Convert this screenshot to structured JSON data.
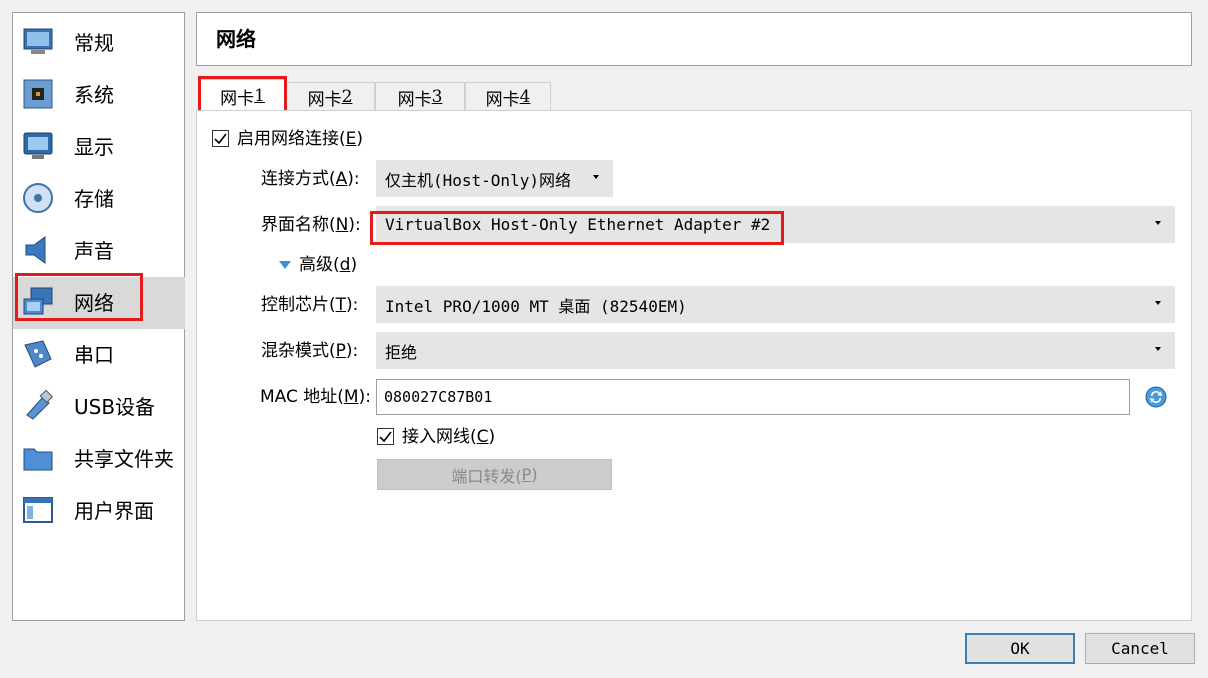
{
  "sidebar": {
    "items": [
      {
        "label": "常规",
        "icon": "general-monitor-icon"
      },
      {
        "label": "系统",
        "icon": "system-chip-icon"
      },
      {
        "label": "显示",
        "icon": "display-monitor-icon"
      },
      {
        "label": "存储",
        "icon": "storage-disk-icon"
      },
      {
        "label": "声音",
        "icon": "audio-speaker-icon"
      },
      {
        "label": "网络",
        "icon": "network-icon"
      },
      {
        "label": "串口",
        "icon": "serial-port-icon"
      },
      {
        "label": "USB设备",
        "icon": "usb-icon"
      },
      {
        "label": "共享文件夹",
        "icon": "shared-folder-icon"
      },
      {
        "label": "用户界面",
        "icon": "user-interface-icon"
      }
    ],
    "selected": "网络"
  },
  "header": {
    "title": "网络"
  },
  "tabs": [
    {
      "prefix": "网卡 ",
      "key": "1"
    },
    {
      "prefix": "网卡 ",
      "key": "2"
    },
    {
      "prefix": "网卡 ",
      "key": "3"
    },
    {
      "prefix": "网卡 ",
      "key": "4"
    }
  ],
  "form": {
    "enable_adapter": {
      "label": "启用网络连接(",
      "key": "E",
      "suffix": ")",
      "checked": true
    },
    "attached_to": {
      "label": "连接方式(",
      "key": "A",
      "suffix": "):",
      "value": "仅主机(Host-Only)网络"
    },
    "name": {
      "label": "界面名称(",
      "key": "N",
      "suffix": "):",
      "value": "VirtualBox Host-Only Ethernet Adapter #2"
    },
    "advanced": {
      "label": "高级(",
      "key": "d",
      "suffix": ")"
    },
    "adapter_type": {
      "label": "控制芯片(",
      "key": "T",
      "suffix": "):",
      "value": "Intel PRO/1000 MT 桌面 (82540EM)"
    },
    "promiscuous": {
      "label": "混杂模式(",
      "key": "P",
      "suffix": "):",
      "value": "拒绝"
    },
    "mac": {
      "label": "MAC 地址(",
      "key": "M",
      "suffix": "):",
      "value": "080027C87B01"
    },
    "cable": {
      "label": "接入网线(",
      "key": "C",
      "suffix": ")",
      "checked": true
    },
    "port_forward": {
      "label": "端口转发(",
      "key": "P",
      "suffix": ")"
    }
  },
  "buttons": {
    "ok": "OK",
    "cancel": "Cancel"
  },
  "colors": {
    "highlight": "#e51b1b",
    "ok_border": "#3c7fb1"
  }
}
